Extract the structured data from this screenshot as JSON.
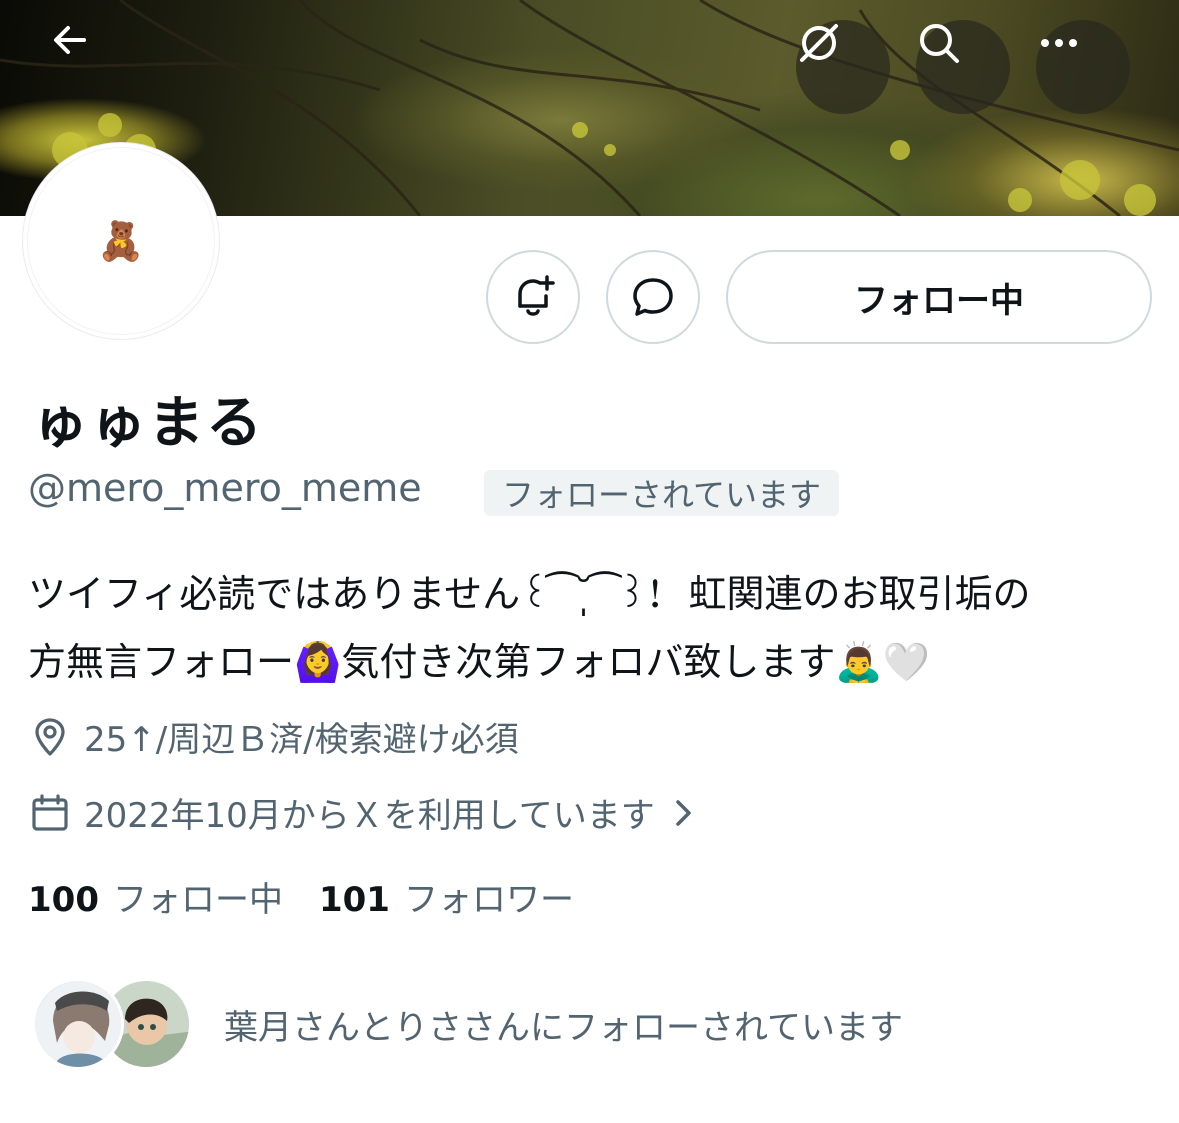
{
  "header": {
    "back_icon": "arrow-left-icon",
    "actions": [
      {
        "icon": "grok-icon"
      },
      {
        "icon": "search-icon"
      },
      {
        "icon": "more-icon"
      }
    ]
  },
  "profile": {
    "avatar_emoji": "🧸",
    "name": "ゅゅまる",
    "handle": "@mero_mero_meme",
    "follows_you_label": "フォローされています",
    "bio_line1": "ツイフィ必読ではありません꒰ ͡ ˘̩̩ ͡ ꒱！ 虹関連のお取引垢の",
    "bio_line2": "方無言フォロー🙆‍♀️気付き次第フォロバ致します🙇‍♂️🤍",
    "location": "25↑/周辺Ｂ済/検索避け必須",
    "joined": "2022年10月からＸを利用しています"
  },
  "buttons": {
    "notify_icon": "bell-plus-icon",
    "message_icon": "message-bubble-icon",
    "following_label": "フォロー中"
  },
  "stats": {
    "following_count": "100",
    "following_label": "フォロー中",
    "followers_count": "101",
    "followers_label": "フォロワー"
  },
  "mutuals": {
    "text": "葉月さんとりささんにフォローされています"
  }
}
